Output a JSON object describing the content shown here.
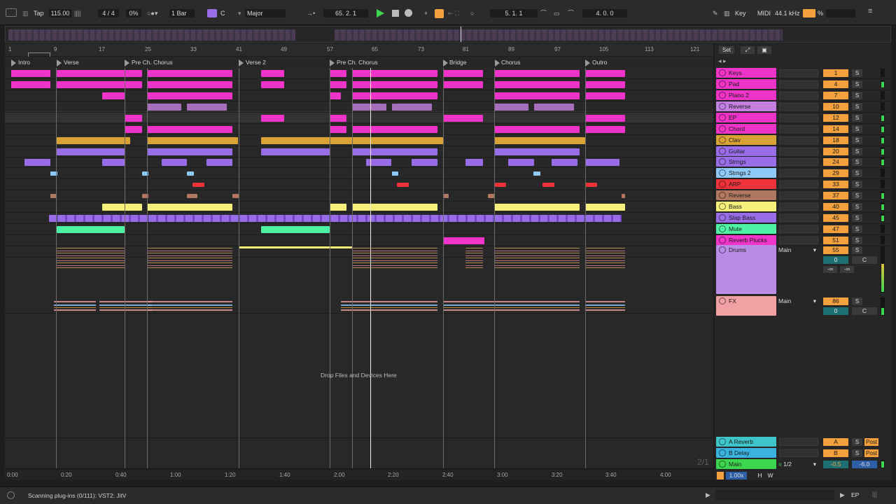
{
  "topbar": {
    "tap": "Tap",
    "tempo": "115.00",
    "time_sig": "4 / 4",
    "groove": "0%",
    "metro": "1 Bar",
    "key_root": "C",
    "scale": "Major",
    "arr_pos": "65.  2.  1",
    "loop_start": "5.  1.  1",
    "loop_len": "4.  0.  0",
    "key_label": "Key",
    "midi_label": "MIDI",
    "sample_rate": "44.1 kHz",
    "cpu": "%"
  },
  "colors": {
    "accent": "#f3a13d",
    "play": "#3dd64f"
  },
  "ruler": {
    "bars": [
      "1",
      "9",
      "17",
      "25",
      "33",
      "41",
      "49",
      "57",
      "65",
      "73",
      "81",
      "89",
      "97",
      "105",
      "113",
      "121"
    ]
  },
  "locators": [
    "Intro",
    "Verse",
    "Pre Ch. Chorus",
    "Verse 2",
    "Pre Ch. Chorus",
    "Bridge",
    "Chorus",
    "Outro"
  ],
  "timeruler": [
    "0:00",
    "0:20",
    "0:40",
    "1:00",
    "1:20",
    "1:40",
    "2:00",
    "2:20",
    "2:40",
    "3:00",
    "3:20",
    "3:40",
    "4:00"
  ],
  "header": {
    "set": "Set"
  },
  "tracks": [
    {
      "name": "Keys",
      "num": "1",
      "color": "#f034c9"
    },
    {
      "name": "Pad",
      "num": "4",
      "color": "#f034c9"
    },
    {
      "name": "Piano 2",
      "num": "7",
      "color": "#f034c9"
    },
    {
      "name": "Reverse",
      "num": "10",
      "color": "#c57fe0"
    },
    {
      "name": "EP",
      "num": "12",
      "color": "#f034c9"
    },
    {
      "name": "Chord",
      "num": "14",
      "color": "#f034c9"
    },
    {
      "name": "Clav",
      "num": "18",
      "color": "#d9a234"
    },
    {
      "name": "Guitar",
      "num": "20",
      "color": "#9a6de8"
    },
    {
      "name": "Strngs",
      "num": "24",
      "color": "#9a6de8"
    },
    {
      "name": "Strngs 2",
      "num": "29",
      "color": "#8fc9f8"
    },
    {
      "name": "ARP",
      "num": "33",
      "color": "#f0333b"
    },
    {
      "name": "Reverse",
      "num": "37",
      "color": "#b07860"
    },
    {
      "name": "Bass",
      "num": "40",
      "color": "#f6f07a"
    },
    {
      "name": "Slap Bass",
      "num": "45",
      "color": "#9a6de8"
    },
    {
      "name": "Mute",
      "num": "47",
      "color": "#4ef2a4"
    },
    {
      "name": "Reverb Plucks",
      "num": "51",
      "color": "#f034c9"
    }
  ],
  "groups": [
    {
      "name": "Drums",
      "num": "55",
      "route": "Main",
      "vol": "0",
      "pan": "C",
      "sendA": "-∞",
      "sendB": "-∞",
      "color": "#b98ce6"
    },
    {
      "name": "FX",
      "num": "86",
      "route": "Main",
      "vol": "0",
      "pan": "C",
      "color": "#f1a0a3"
    }
  ],
  "returns": [
    {
      "name": "A Reverb",
      "letter": "A",
      "post": "Post",
      "color": "#3ec5c9"
    },
    {
      "name": "B Delay",
      "letter": "B",
      "post": "Post",
      "color": "#3ab3e0"
    }
  ],
  "master": {
    "name": "Main",
    "route": "1/2",
    "vol": "-0.5",
    "vol2": "-6.0",
    "zoom": "1.00x",
    "h": "H",
    "w": "W",
    "page": "2/1"
  },
  "drop_text": "Drop Files and Devices Here",
  "status": {
    "text": "Scanning plug-ins (0/111): VST2: JitV",
    "ep": "EP"
  }
}
